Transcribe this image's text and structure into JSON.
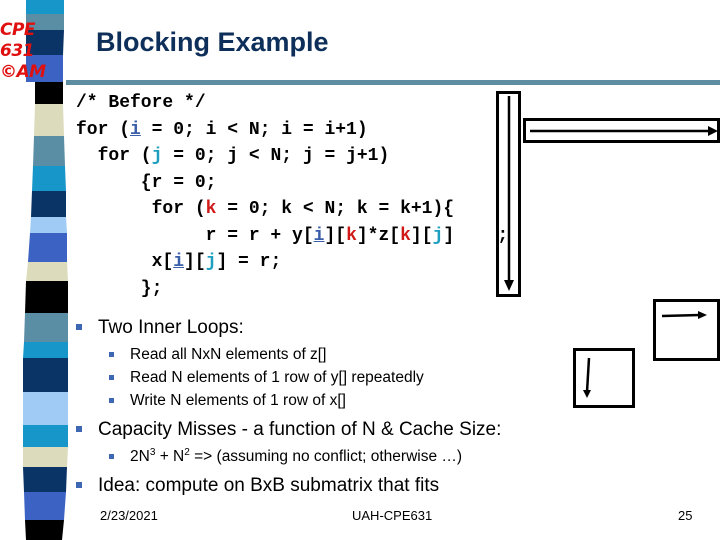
{
  "logo": {
    "line1": "CPE",
    "line2": "631",
    "line3": "©AM"
  },
  "title": "Blocking Example",
  "code": {
    "lines": [
      [
        {
          "t": "/* Before */"
        }
      ],
      [
        {
          "t": "for ("
        },
        {
          "t": "i",
          "c": "vi"
        },
        {
          "t": " = 0; i < N; i = i+1)"
        }
      ],
      [
        {
          "t": "  for ("
        },
        {
          "t": "j",
          "c": "vj"
        },
        {
          "t": " = 0; j < N; j = j+1)"
        }
      ],
      [
        {
          "t": "      {r = 0;"
        }
      ],
      [
        {
          "t": "       for ("
        },
        {
          "t": "k",
          "c": "vk"
        },
        {
          "t": " = 0; k < N; k = k+1){"
        }
      ],
      [
        {
          "t": "            r = r + y["
        },
        {
          "t": "i",
          "c": "vi"
        },
        {
          "t": "]["
        },
        {
          "t": "k",
          "c": "vk"
        },
        {
          "t": "]*z["
        },
        {
          "t": "k",
          "c": "vk"
        },
        {
          "t": "]["
        },
        {
          "t": "j",
          "c": "vj"
        },
        {
          "t": "]    ;"
        }
      ],
      [
        {
          "t": "       x["
        },
        {
          "t": "i",
          "c": "vi"
        },
        {
          "t": "]["
        },
        {
          "t": "j",
          "c": "vj"
        },
        {
          "t": "] = r;"
        }
      ],
      [
        {
          "t": "      };"
        }
      ]
    ]
  },
  "bullets": {
    "b1": "Two Inner Loops:",
    "b1_sub": [
      "Read all NxN elements of z[]",
      "Read N elements of 1 row of y[] repeatedly",
      "Write N elements of 1 row  of x[]"
    ],
    "b2": "Capacity Misses - a function of N & Cache Size:",
    "b2_sub": {
      "pre": "2N",
      "sup1": "3",
      "mid": " + N",
      "sup2": "2",
      "post": " => (assuming no conflict; otherwise …)"
    },
    "b3": "Idea: compute on BxB submatrix that fits"
  },
  "footer": {
    "date": "2/23/2021",
    "center": "UAH-CPE631",
    "page": "25"
  },
  "colors": {
    "title": "#0d2f5a",
    "logo": "#e01010",
    "rule": "#5f8ea3",
    "bullet": "#3d67b3",
    "var_i": "#3a5fa8",
    "var_j": "#1f9fc0",
    "var_k": "#d01a1a"
  }
}
